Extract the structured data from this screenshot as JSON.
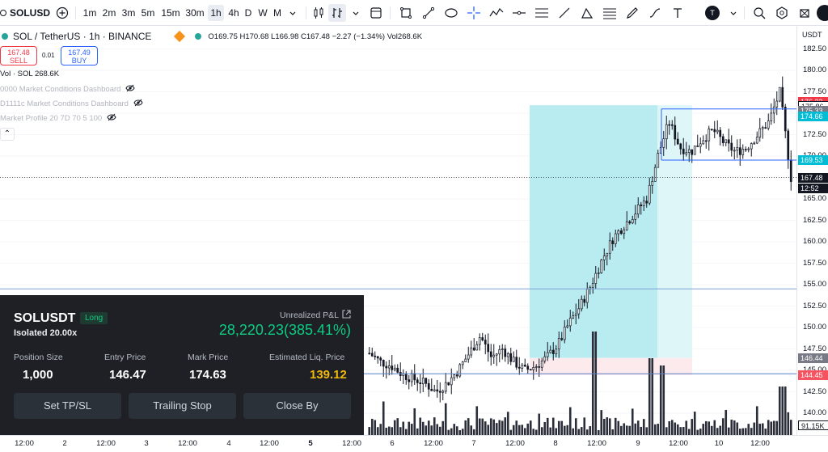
{
  "toolbar": {
    "symbol": "SOLUSD",
    "intervals": [
      "1m",
      "2m",
      "3m",
      "5m",
      "15m",
      "30m",
      "1h",
      "4h",
      "D",
      "W",
      "M"
    ],
    "active_interval": "1h",
    "user_avatar": "T",
    "icons": [
      "add-symbol-icon",
      "chevron-down-icon",
      "candles-icon",
      "indicators-icon",
      "templates-icon",
      "rectangle-icon",
      "trendline-icon",
      "shape-icon",
      "crosshair-icon",
      "path-icon",
      "horizontal-line-icon",
      "parallel-channel-icon",
      "line-tool-icon",
      "triangle-icon",
      "gann-box-icon",
      "brush-icon",
      "text-icon",
      "zoom-icon",
      "settings-icon",
      "camera-icon"
    ]
  },
  "legend": {
    "title": "SOL / TetherUS · 1h · BINANCE",
    "ohlc": "O169.75 H170.68 L166.98 C167.48 −2.27 (−1.34%) Vol268.6K",
    "sell_price": "167.48",
    "sell_label": "SELL",
    "buy_price": "167.49",
    "buy_label": "BUY",
    "spread": "0.01",
    "volume": "Vol · SOL  268.6K",
    "indicators": [
      "0000 Market Conditions Dashboard",
      "D1111c Market Conditions Dashboard",
      "Market Profile 20 7D 70 5 100"
    ],
    "collapse": "⌃"
  },
  "price_axis": {
    "currency": "USDT",
    "ticks": [
      "182.50",
      "180.00",
      "177.50",
      "175.00",
      "172.50",
      "170.00",
      "167.50",
      "165.00",
      "162.50",
      "160.00",
      "157.50",
      "155.00",
      "152.50",
      "150.00",
      "147.50",
      "145.00",
      "142.50",
      "140.00"
    ],
    "tags": [
      {
        "text": "176.32",
        "color": "#f23645"
      },
      {
        "text": "175.86",
        "color": "#ffffff",
        "fg": "#131722"
      },
      {
        "text": "175.33",
        "color": "#787b86"
      },
      {
        "text": "174.66",
        "color": "#00bcd4"
      },
      {
        "text": "169.53",
        "color": "#00bcd4"
      },
      {
        "text": "167.48",
        "color": "#131722"
      },
      {
        "text": "12:52",
        "color": "#131722"
      },
      {
        "text": "146.44",
        "color": "#787b86"
      },
      {
        "text": "144.45",
        "color": "#f7525f"
      },
      {
        "text": "91.15K",
        "color": "#ffffff",
        "fg": "#131722"
      }
    ]
  },
  "time_axis": {
    "labels": [
      {
        "text": "12:00"
      },
      {
        "text": "2"
      },
      {
        "text": "12:00"
      },
      {
        "text": "3"
      },
      {
        "text": "12:00"
      },
      {
        "text": "4"
      },
      {
        "text": "12:00"
      },
      {
        "text": "5",
        "bold": true
      },
      {
        "text": "12:00"
      },
      {
        "text": "6"
      },
      {
        "text": "12:00"
      },
      {
        "text": "7"
      },
      {
        "text": "12:00"
      },
      {
        "text": "8"
      },
      {
        "text": "12:00"
      },
      {
        "text": "9"
      },
      {
        "text": "12:00"
      },
      {
        "text": "10"
      },
      {
        "text": "12:00"
      }
    ]
  },
  "position": {
    "symbol": "SOLUSDT",
    "side": "Long",
    "margin_mode": "Isolated 20.00x",
    "upnl_label": "Unrealized P&L",
    "upnl_value": "28,220.23(385.41%)",
    "size_label": "Position Size",
    "size_value": "1,000",
    "entry_label": "Entry Price",
    "entry_value": "146.47",
    "mark_label": "Mark Price",
    "mark_value": "174.63",
    "liq_label": "Estimated Liq. Price",
    "liq_value": "139.12",
    "buttons": [
      "Set TP/SL",
      "Trailing Stop",
      "Close By"
    ]
  },
  "colors": {
    "up": "#26a69a",
    "down": "#131722",
    "profit_zone": "#b2ebf2",
    "loss_zone": "#fde2e4",
    "pnl_green": "#0ecb81",
    "liq_orange": "#f0b90b",
    "line_blue": "#2962ff"
  },
  "chart_data": {
    "type": "candlestick",
    "symbol": "SOLUSDT",
    "interval": "1h",
    "ylim": [
      139,
      183
    ],
    "last_price": 167.48,
    "position_tool": {
      "entry": 146.44,
      "target": 175.33,
      "stop": 144.45
    },
    "horizontal_lines": [
      154.5,
      144.6,
      169.53
    ],
    "series_close_approx": [
      147,
      146,
      145.5,
      144.5,
      144,
      143.5,
      142.5,
      143.5,
      145,
      147,
      149,
      146.5,
      147.5,
      146,
      145,
      145.5,
      146.5,
      148,
      150.5,
      152.5,
      155,
      158,
      160.5,
      162,
      163.5,
      165,
      170,
      174,
      171,
      170.5,
      172,
      173,
      171.5,
      170.5,
      171,
      172.5,
      174,
      177.5,
      167.48
    ]
  }
}
